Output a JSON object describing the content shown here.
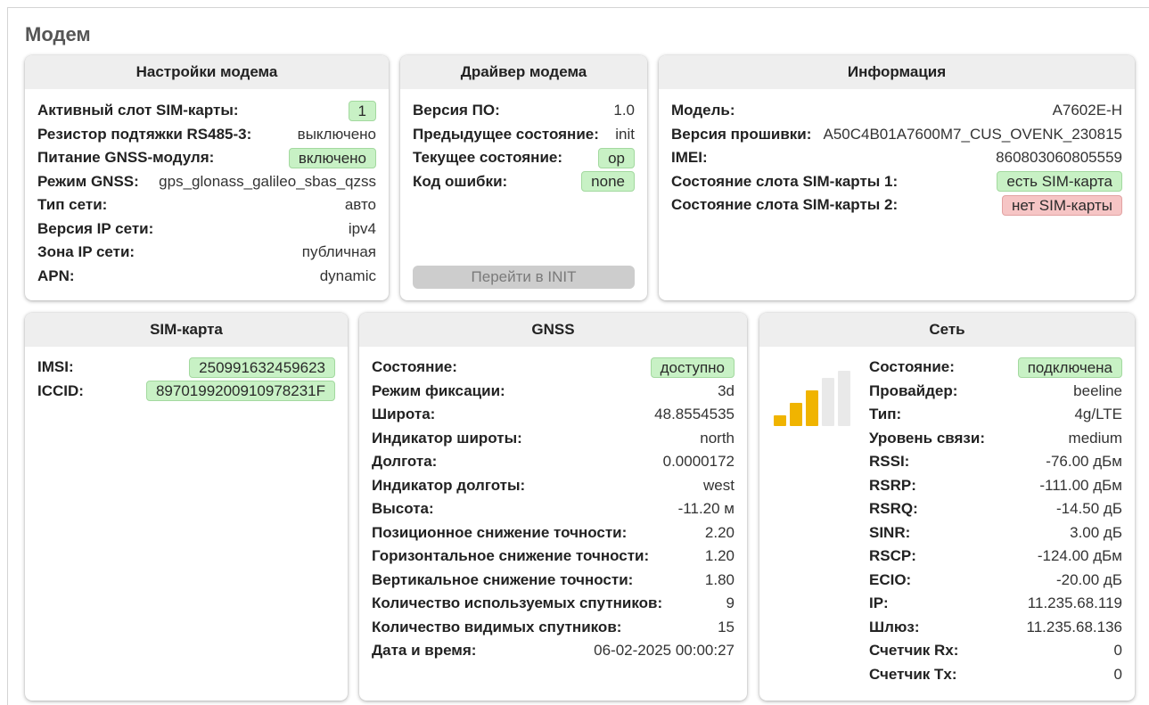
{
  "page": {
    "title": "Модем"
  },
  "colors": {
    "badge_ok": "#c8f1c5",
    "badge_ok_border": "#a3d99f",
    "badge_error": "#f6c5c5",
    "badge_error_border": "#e2a2a2",
    "card_header": "#eeeeee",
    "signal_active": "#f0b400",
    "signal_inactive": "#e9e9e9"
  },
  "modem_settings": {
    "title": "Настройки модема",
    "rows": [
      {
        "label": "Активный слот SIM-карты:",
        "value": "1"
      },
      {
        "label": "Резистор подтяжки RS485-3:",
        "value": "выключено"
      },
      {
        "label": "Питание GNSS-модуля:",
        "value": "включено"
      },
      {
        "label": "Режим GNSS:",
        "value": "gps_glonass_galileo_sbas_qzss"
      },
      {
        "label": "Тип сети:",
        "value": "авто"
      },
      {
        "label": "Версия IP сети:",
        "value": "ipv4"
      },
      {
        "label": "Зона IP сети:",
        "value": "публичная"
      },
      {
        "label": "APN:",
        "value": "dynamic"
      }
    ]
  },
  "modem_driver": {
    "title": "Драйвер модема",
    "rows": [
      {
        "label": "Версия ПО:",
        "value": "1.0"
      },
      {
        "label": "Предыдущее состояние:",
        "value": "init"
      },
      {
        "label": "Текущее состояние:",
        "value": "op"
      },
      {
        "label": "Код ошибки:",
        "value": "none"
      }
    ],
    "init_button": "Перейти в INIT"
  },
  "information": {
    "title": "Информация",
    "rows": [
      {
        "label": "Модель:",
        "value": "A7602E-H"
      },
      {
        "label": "Версия прошивки:",
        "value": "A50C4B01A7600M7_CUS_OVENK_230815"
      },
      {
        "label": "IMEI:",
        "value": "860803060805559"
      },
      {
        "label": "Состояние слота SIM-карты 1:",
        "value": "есть SIM-карта"
      },
      {
        "label": "Состояние слота SIM-карты 2:",
        "value": "нет SIM-карты"
      }
    ]
  },
  "sim_card": {
    "title": "SIM-карта",
    "rows": [
      {
        "label": "IMSI:",
        "value": "250991632459623"
      },
      {
        "label": "ICCID:",
        "value": "8970199200910978231F"
      }
    ]
  },
  "gnss": {
    "title": "GNSS",
    "rows": [
      {
        "label": "Состояние:",
        "value": "доступно"
      },
      {
        "label": "Режим фиксации:",
        "value": "3d"
      },
      {
        "label": "Широта:",
        "value": "48.8554535"
      },
      {
        "label": "Индикатор широты:",
        "value": "north"
      },
      {
        "label": "Долгота:",
        "value": "0.0000172"
      },
      {
        "label": "Индикатор долготы:",
        "value": "west"
      },
      {
        "label": "Высота:",
        "value": "-11.20 м"
      },
      {
        "label": "Позиционное снижение точности:",
        "value": "2.20"
      },
      {
        "label": "Горизонтальное снижение точности:",
        "value": "1.20"
      },
      {
        "label": "Вертикальное снижение точности:",
        "value": "1.80"
      },
      {
        "label": "Количество используемых спутников:",
        "value": "9"
      },
      {
        "label": "Количество видимых спутников:",
        "value": "15"
      },
      {
        "label": "Дата и время:",
        "value": "06-02-2025 00:00:27"
      }
    ]
  },
  "network": {
    "title": "Сеть",
    "signal": {
      "filled_bars": 3,
      "total_bars": 5
    },
    "rows": [
      {
        "label": "Состояние:",
        "value": "подключена"
      },
      {
        "label": "Провайдер:",
        "value": "beeline"
      },
      {
        "label": "Тип:",
        "value": "4g/LTE"
      },
      {
        "label": "Уровень связи:",
        "value": "medium"
      },
      {
        "label": "RSSI:",
        "value": "-76.00 дБм"
      },
      {
        "label": "RSRP:",
        "value": "-111.00 дБм"
      },
      {
        "label": "RSRQ:",
        "value": "-14.50 дБ"
      },
      {
        "label": "SINR:",
        "value": "3.00 дБ"
      },
      {
        "label": "RSCP:",
        "value": "-124.00 дБм"
      },
      {
        "label": "ECIO:",
        "value": "-20.00 дБ"
      },
      {
        "label": "IP:",
        "value": "11.235.68.119"
      },
      {
        "label": "Шлюз:",
        "value": "11.235.68.136"
      },
      {
        "label": "Счетчик Rx:",
        "value": "0"
      },
      {
        "label": "Счетчик Tx:",
        "value": "0"
      }
    ]
  }
}
